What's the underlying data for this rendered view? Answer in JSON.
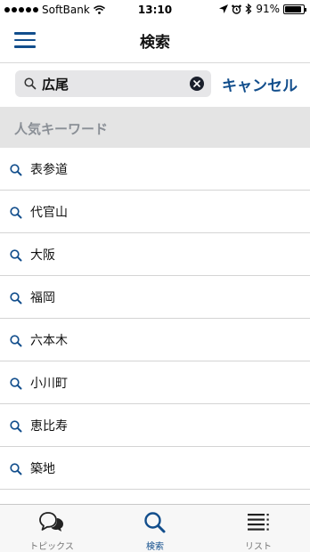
{
  "status": {
    "carrier": "SoftBank",
    "time": "13:10",
    "battery": "91%",
    "battery_level": 0.91
  },
  "nav": {
    "title": "検索"
  },
  "search": {
    "value": "広尾",
    "cancel_label": "キャンセル"
  },
  "section": {
    "title": "人気キーワード"
  },
  "keywords": [
    "表参道",
    "代官山",
    "大阪",
    "福岡",
    "六本木",
    "小川町",
    "恵比寿",
    "築地"
  ],
  "tabs": [
    {
      "label": "トピックス",
      "icon": "speech-bubbles-icon",
      "active": false
    },
    {
      "label": "検索",
      "icon": "search-icon",
      "active": true
    },
    {
      "label": "リスト",
      "icon": "list-icon",
      "active": false
    }
  ],
  "colors": {
    "accent": "#124e8c",
    "header_bg": "#e4e4e4",
    "search_bg": "#e6e6e8"
  }
}
